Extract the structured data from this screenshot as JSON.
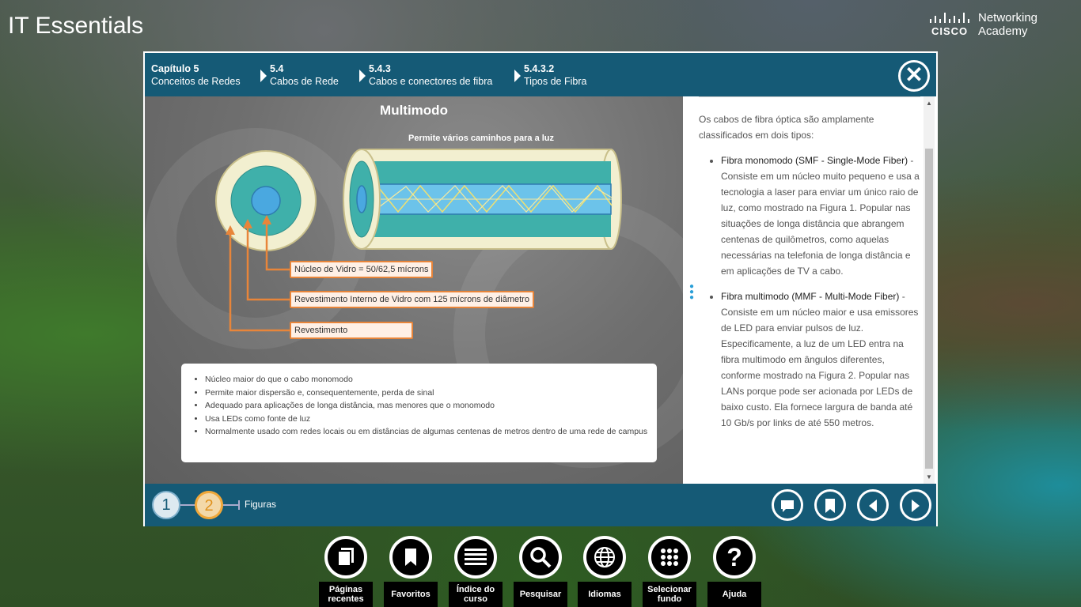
{
  "app": {
    "title": "IT Essentials",
    "logo_brand": "CISCO",
    "logo_line1": "Networking",
    "logo_line2": "Academy"
  },
  "breadcrumb": [
    {
      "num": "Capítulo 5",
      "label": "Conceitos de Redes"
    },
    {
      "num": "5.4",
      "label": "Cabos de Rede"
    },
    {
      "num": "5.4.3",
      "label": "Cabos e conectores de fibra"
    },
    {
      "num": "5.4.3.2",
      "label": "Tipos de Fibra"
    }
  ],
  "figure": {
    "title": "Multimodo",
    "subtitle": "Permite vários caminhos para a luz",
    "labels": {
      "core": "Núcleo de Vidro = 50/62,5 mícrons",
      "cladding": "Revestimento Interno de Vidro com 125 mícrons de diâmetro",
      "coating": "Revestimento"
    },
    "bullets": [
      "Núcleo maior do que o cabo monomodo",
      "Permite maior dispersão e, consequentemente, perda de sinal",
      "Adequado para aplicações de longa distância, mas menores que o monomodo",
      "Usa LEDs como fonte de luz",
      "Normalmente usado com redes locais ou em distâncias de algumas centenas de metros dentro de uma rede de campus"
    ]
  },
  "text": {
    "intro": "Os cabos de fibra óptica são amplamente classificados em dois tipos:",
    "items": [
      {
        "term": "Fibra monomodo (SMF - Single-Mode Fiber)",
        "desc": " - Consiste em um núcleo muito pequeno e usa a tecnologia a laser para enviar um único raio de luz, como mostrado na Figura 1. Popular nas situações de longa distância que abrangem centenas de quilômetros, como aquelas necessárias na telefonia de longa distância e em aplicações de TV a cabo."
      },
      {
        "term": "Fibra multimodo (MMF - Multi-Mode Fiber)",
        "desc": " - Consiste em um núcleo maior e usa emissores de LED para enviar pulsos de luz. Especificamente, a luz de um LED entra na fibra multimodo em ângulos diferentes, conforme mostrado na Figura 2. Popular nas LANs porque pode ser acionada por LEDs de baixo custo. Ela fornece largura de banda até 10 Gb/s por links de até 550 metros."
      }
    ]
  },
  "pager": {
    "pages": [
      "1",
      "2"
    ],
    "current": "2",
    "label": "Figuras"
  },
  "dock": [
    {
      "label": "Páginas recentes",
      "icon": "pages-icon"
    },
    {
      "label": "Favoritos",
      "icon": "bookmark-icon"
    },
    {
      "label": "Índice do curso",
      "icon": "list-icon"
    },
    {
      "label": "Pesquisar",
      "icon": "search-icon"
    },
    {
      "label": "Idiomas",
      "icon": "globe-icon"
    },
    {
      "label": "Selecionar fundo",
      "icon": "grid-icon"
    },
    {
      "label": "Ajuda",
      "icon": "help-icon"
    }
  ],
  "colors": {
    "bar": "#155a76",
    "accent_orange": "#e8853a",
    "fiber_teal": "#3fb0aa",
    "fiber_core": "#4aa8e0"
  }
}
